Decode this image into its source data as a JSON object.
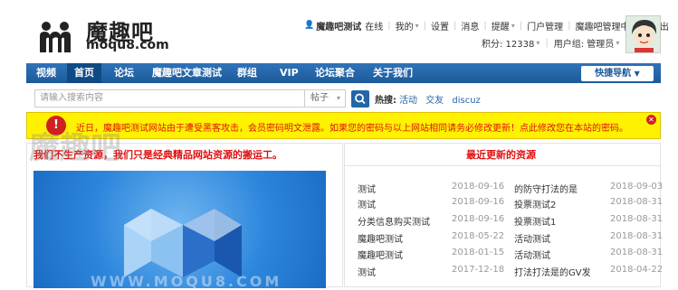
{
  "logo": {
    "name_cn": "魔趣吧",
    "name_en": "moqu8.com"
  },
  "topbar": {
    "user": "魔趣吧测试",
    "status": "在线",
    "links": [
      "我的",
      "设置",
      "消息",
      "提醒",
      "门户管理",
      "魔趣吧管理中心",
      "退出"
    ]
  },
  "userinfo": {
    "points_label": "积分: 12338",
    "group_label": "用户组: 管理员"
  },
  "nav": {
    "items": [
      "视频",
      "首页",
      "论坛",
      "魔趣吧文章测试",
      "群组",
      "VIP",
      "论坛聚合",
      "关于我们"
    ],
    "quick_nav": "快捷导航"
  },
  "search": {
    "placeholder": "请输入搜索内容",
    "type": "帖子",
    "hot_label": "热搜:",
    "hot_words": [
      "活动",
      "交友",
      "discuz"
    ]
  },
  "notice": {
    "icon": "!",
    "text": "近日，魔趣吧测试网站由于遭受黑客攻击，会员密码明文泄露。如果您的密码与以上网站相同请务必修改更新！点此修改您在本站的密码。"
  },
  "left": {
    "title": "我们不生产资源，我们只是经典精品网站资源的搬运工。",
    "watermark": "魔趣吧",
    "watermark2": "WWW.MOQU8.COM"
  },
  "right": {
    "title": "最近更新的资源",
    "col1": [
      {
        "title": "测试",
        "date": "2018-09-16"
      },
      {
        "title": "测试",
        "date": "2018-09-16"
      },
      {
        "title": "分类信息购买测试",
        "date": "2018-09-16"
      },
      {
        "title": "魔趣吧测试",
        "date": "2018-05-22"
      },
      {
        "title": "魔趣吧测试",
        "date": "2018-01-15"
      },
      {
        "title": "测试",
        "date": "2017-12-18"
      }
    ],
    "col2": [
      {
        "title": "的防守打法的是",
        "date": "2018-09-03"
      },
      {
        "title": "投票测试2",
        "date": "2018-08-31"
      },
      {
        "title": "投票测试1",
        "date": "2018-08-31"
      },
      {
        "title": "活动测试",
        "date": "2018-08-31"
      },
      {
        "title": "活动测试",
        "date": "2018-08-31"
      },
      {
        "title": "打法打法是的GV发",
        "date": "2018-04-22"
      }
    ]
  },
  "colors": {
    "nav_blue": "#2366a8",
    "notice_yellow": "#fff200",
    "alert_red": "#e01010"
  }
}
